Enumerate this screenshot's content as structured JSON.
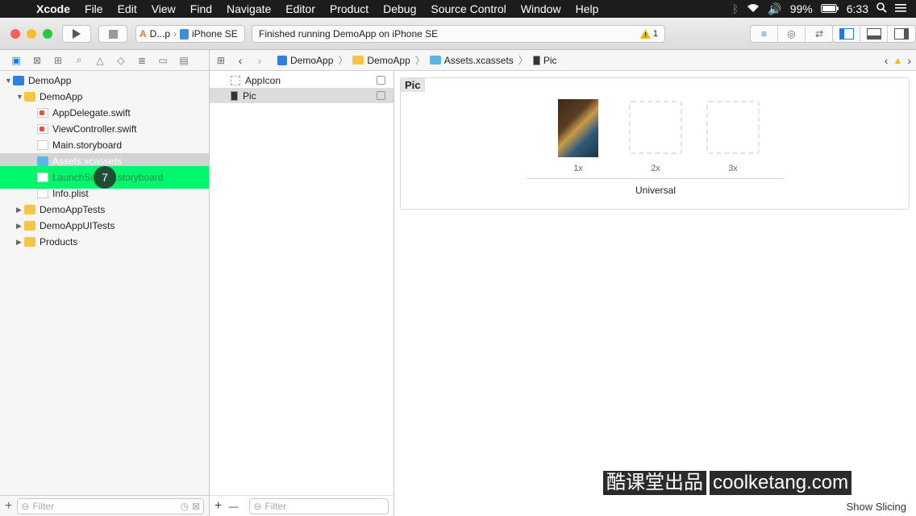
{
  "menubar": {
    "apple": "",
    "app": "Xcode",
    "items": [
      "File",
      "Edit",
      "View",
      "Find",
      "Navigate",
      "Editor",
      "Product",
      "Debug",
      "Source Control",
      "Window",
      "Help"
    ],
    "battery": "99%",
    "time": "6:33"
  },
  "toolbar": {
    "scheme_target": "D...p",
    "scheme_device": "iPhone SE",
    "status_text": "Finished running DemoApp on iPhone SE",
    "warning_count": "1"
  },
  "navigator": {
    "rows": [
      {
        "label": "DemoApp",
        "depth": 0,
        "disclosure": "▼",
        "icon": "project-icon"
      },
      {
        "label": "DemoApp",
        "depth": 1,
        "disclosure": "▼",
        "icon": "folder-icon"
      },
      {
        "label": "AppDelegate.swift",
        "depth": 2,
        "disclosure": "",
        "icon": "swift-file-icon"
      },
      {
        "label": "ViewController.swift",
        "depth": 2,
        "disclosure": "",
        "icon": "swift-file-icon"
      },
      {
        "label": "Main.storyboard",
        "depth": 2,
        "disclosure": "",
        "icon": "storyboard-icon"
      },
      {
        "label": "Assets.xcassets",
        "depth": 2,
        "disclosure": "",
        "icon": "assets-icon"
      },
      {
        "label": "LaunchScreen.storyboard",
        "depth": 2,
        "disclosure": "",
        "icon": "storyboard-icon"
      },
      {
        "label": "Info.plist",
        "depth": 2,
        "disclosure": "",
        "icon": "plist-icon"
      },
      {
        "label": "DemoAppTests",
        "depth": 1,
        "disclosure": "▶",
        "icon": "folder-icon"
      },
      {
        "label": "DemoAppUITests",
        "depth": 1,
        "disclosure": "▶",
        "icon": "folder-icon"
      },
      {
        "label": "Products",
        "depth": 1,
        "disclosure": "▶",
        "icon": "folder-icon"
      }
    ],
    "step_badge": "7",
    "filter_placeholder": "Filter"
  },
  "jumpbar": {
    "crumbs": [
      "DemoApp",
      "DemoApp",
      "Assets.xcassets",
      "Pic"
    ]
  },
  "asset_list": {
    "items": [
      "AppIcon",
      "Pic"
    ],
    "filter_placeholder": "Filter",
    "add": "+",
    "remove": "—"
  },
  "editor": {
    "set_name": "Pic",
    "slots": [
      "1x",
      "2x",
      "3x"
    ],
    "group_label": "Universal",
    "show_slicing": "Show Slicing"
  },
  "watermark": {
    "cn": "酷课堂出品",
    "site": "coolketang.com"
  },
  "colors": {
    "highlight": "#00f66b",
    "badge": "#1f4d35",
    "menubar": "#1c1c1c",
    "folder": "#f6c543"
  }
}
